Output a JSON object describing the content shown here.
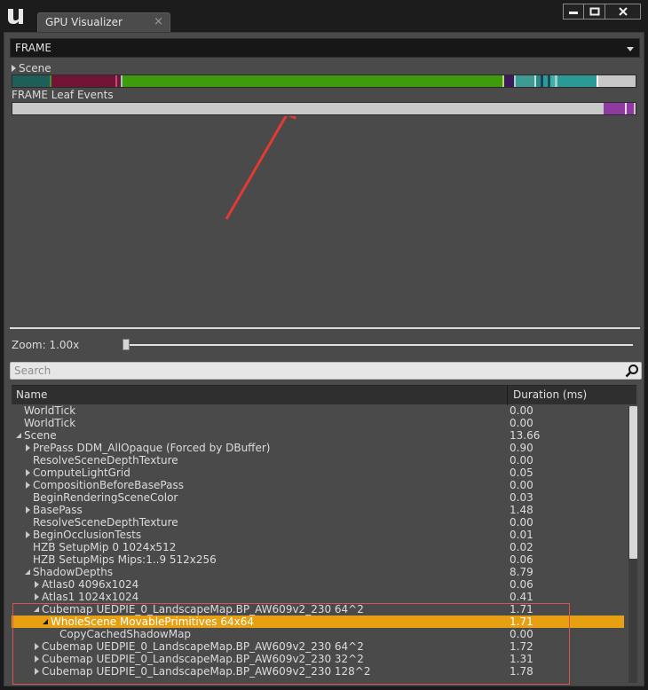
{
  "window": {
    "tab_title": "GPU Visualizer",
    "tab_close": "×",
    "min_glyph": "▬",
    "max_glyph": "□",
    "close_glyph": "✕"
  },
  "frame_select": {
    "value": "FRAME"
  },
  "scene_track": {
    "label": "Scene",
    "segments": [
      {
        "w": 42,
        "color": "#1f5f5a"
      },
      {
        "w": 2,
        "color": "#4e8d2a"
      },
      {
        "w": 72,
        "color": "#6f1434"
      },
      {
        "w": 2,
        "color": "#c04a7a"
      },
      {
        "w": 4,
        "color": "#6f1434"
      },
      {
        "w": 2,
        "color": "#9cc8c0"
      },
      {
        "w": 428,
        "color": "#3f9a0e"
      },
      {
        "w": 2,
        "color": "#b9d676"
      },
      {
        "w": 11,
        "color": "#3a1a58"
      },
      {
        "w": 2,
        "color": "#9bd6c8"
      },
      {
        "w": 21,
        "color": "#3e9a92"
      },
      {
        "w": 2,
        "color": "#c4e0dc"
      },
      {
        "w": 5,
        "color": "#2a8a84"
      },
      {
        "w": 3,
        "color": "#1c3c6a"
      },
      {
        "w": 5,
        "color": "#2f9a8e"
      },
      {
        "w": 3,
        "color": "#1a4a60"
      },
      {
        "w": 5,
        "color": "#3fb0a4"
      },
      {
        "w": 3,
        "color": "#9ad0c8"
      },
      {
        "w": 44,
        "color": "#2b9a94"
      },
      {
        "w": 2,
        "color": "#ffffff"
      },
      {
        "w": 36,
        "color": "#c8c8c8"
      }
    ]
  },
  "leaf_track": {
    "label": "FRAME Leaf Events",
    "segments": [
      {
        "w": 666,
        "color": "#c9c9c9"
      },
      {
        "w": 24,
        "color": "#8f3aa0"
      },
      {
        "w": 2,
        "color": "#e6d6ea"
      },
      {
        "w": 8,
        "color": "#8f3aa0"
      }
    ]
  },
  "zoom": {
    "label": "Zoom: 1.00x",
    "value": 1.0
  },
  "search": {
    "placeholder": "Search"
  },
  "table": {
    "col_name": "Name",
    "col_duration": "Duration (ms)",
    "rows": [
      {
        "name": "WorldTick",
        "duration": "0.00",
        "level": 0,
        "expander": "none"
      },
      {
        "name": "WorldTick",
        "duration": "0.00",
        "level": 0,
        "expander": "none"
      },
      {
        "name": "Scene",
        "duration": "13.66",
        "level": 0,
        "expander": "expanded"
      },
      {
        "name": "PrePass DDM_AllOpaque (Forced by DBuffer)",
        "duration": "0.90",
        "level": 1,
        "expander": "collapsed"
      },
      {
        "name": "ResolveSceneDepthTexture",
        "duration": "0.00",
        "level": 1,
        "expander": "none"
      },
      {
        "name": "ComputeLightGrid",
        "duration": "0.05",
        "level": 1,
        "expander": "collapsed"
      },
      {
        "name": "CompositionBeforeBasePass",
        "duration": "0.00",
        "level": 1,
        "expander": "collapsed"
      },
      {
        "name": "BeginRenderingSceneColor",
        "duration": "0.03",
        "level": 1,
        "expander": "none"
      },
      {
        "name": "BasePass",
        "duration": "1.48",
        "level": 1,
        "expander": "collapsed"
      },
      {
        "name": "ResolveSceneDepthTexture",
        "duration": "0.00",
        "level": 1,
        "expander": "none"
      },
      {
        "name": "BeginOcclusionTests",
        "duration": "0.01",
        "level": 1,
        "expander": "collapsed"
      },
      {
        "name": "HZB SetupMip 0 1024x512",
        "duration": "0.02",
        "level": 1,
        "expander": "none"
      },
      {
        "name": "HZB SetupMips Mips:1..9 512x256",
        "duration": "0.06",
        "level": 1,
        "expander": "none"
      },
      {
        "name": "ShadowDepths",
        "duration": "8.79",
        "level": 1,
        "expander": "expanded"
      },
      {
        "name": "Atlas0 4096x1024",
        "duration": "0.06",
        "level": 2,
        "expander": "collapsed"
      },
      {
        "name": "Atlas1 1024x1024",
        "duration": "0.41",
        "level": 2,
        "expander": "collapsed"
      },
      {
        "name": "Cubemap UEDPIE_0_LandscapeMap.BP_AW609v2_230 64^2",
        "duration": "1.71",
        "level": 2,
        "expander": "expanded"
      },
      {
        "name": "WholeScene MovablePrimitives 64x64",
        "duration": "1.71",
        "level": 3,
        "expander": "expanded",
        "selected": true
      },
      {
        "name": "CopyCachedShadowMap",
        "duration": "0.00",
        "level": 4,
        "expander": "none"
      },
      {
        "name": "Cubemap UEDPIE_0_LandscapeMap.BP_AW609v2_230 64^2",
        "duration": "1.72",
        "level": 2,
        "expander": "collapsed"
      },
      {
        "name": "Cubemap UEDPIE_0_LandscapeMap.BP_AW609v2_230 32^2",
        "duration": "1.31",
        "level": 2,
        "expander": "collapsed"
      },
      {
        "name": "Cubemap UEDPIE_0_LandscapeMap.BP_AW609v2_230 128^2",
        "duration": "1.78",
        "level": 2,
        "expander": "collapsed"
      }
    ]
  },
  "colors": {
    "selection": "#e6a012",
    "annotation": "#e53935"
  }
}
